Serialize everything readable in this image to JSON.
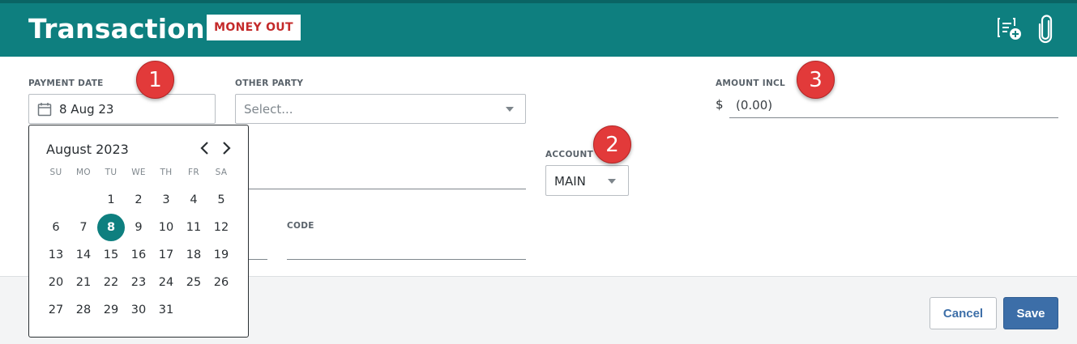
{
  "header": {
    "title": "Transaction",
    "badge": "MONEY OUT",
    "icons": [
      "notes-add-icon",
      "paperclip-icon"
    ],
    "color": "#0e7f7f"
  },
  "payment_date": {
    "label": "PAYMENT DATE",
    "value": "8 Aug 23"
  },
  "other_party": {
    "label": "OTHER PARTY",
    "placeholder": "Select..."
  },
  "account": {
    "label": "ACCOUNT",
    "value": "MAIN"
  },
  "amount": {
    "label": "AMOUNT INCL",
    "currency": "$",
    "value": "(0.00)"
  },
  "code": {
    "label": "CODE"
  },
  "calendar": {
    "month": "August 2023",
    "weekdays": [
      "SU",
      "MO",
      "TU",
      "WE",
      "TH",
      "FR",
      "SA"
    ],
    "first_weekday_index": 2,
    "days_in_month": 31,
    "selected_day": 8,
    "selected_color": "#0e7f7f"
  },
  "footer": {
    "cancel_label": "Cancel",
    "save_label": "Save",
    "save_color": "#3c6ea8"
  },
  "markers": [
    "1",
    "2",
    "3"
  ]
}
